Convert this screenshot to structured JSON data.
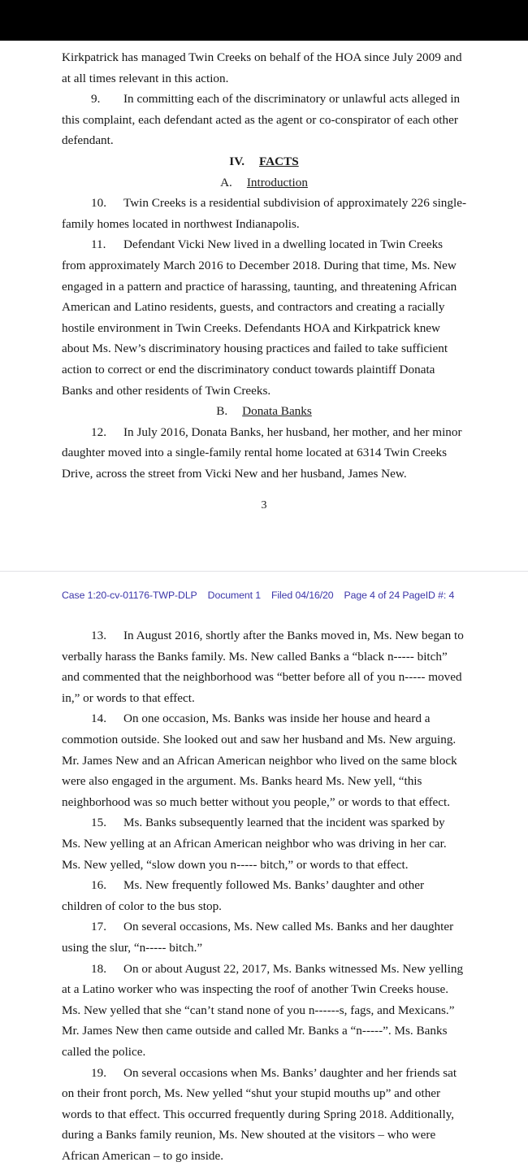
{
  "viewer": {
    "top_band_label": "pdf-toolbar-band"
  },
  "page_one": {
    "continued_paragraph": "Kirkpatrick has managed Twin Creeks on behalf of the HOA since July 2009 and at all times relevant in this action.",
    "paragraphs": [
      {
        "number": "9.",
        "text": "In committing each of the discriminatory or unlawful acts alleged in this complaint, each defendant acted as the agent or co-conspirator of each other defendant."
      }
    ],
    "heading_roman": {
      "numeral": "IV.",
      "label": "FACTS"
    },
    "heading_alpha_a": {
      "letter": "A.",
      "label": "Introduction"
    },
    "paragraphs_after_a": [
      {
        "number": "10.",
        "text": "Twin Creeks is a residential subdivision of approximately 226 single-family homes located in northwest Indianapolis."
      },
      {
        "number": "11.",
        "text": "Defendant Vicki New lived in a dwelling located in Twin Creeks from approximately March 2016 to December 2018. During that time, Ms. New engaged in a pattern and practice of harassing, taunting, and threatening African American and Latino residents, guests, and contractors and creating a racially hostile environment in Twin Creeks. Defendants HOA and Kirkpatrick knew about Ms. New’s discriminatory housing practices and failed to take sufficient action to correct or end the discriminatory conduct towards plaintiff Donata Banks and other residents of Twin Creeks."
      }
    ],
    "heading_alpha_b": {
      "letter": "B.",
      "label": "Donata Banks"
    },
    "paragraphs_after_b": [
      {
        "number": "12.",
        "text": "In July 2016, Donata Banks, her husband, her mother, and her minor daughter moved into a single-family rental home located at 6314 Twin Creeks Drive, across the street from Vicki New and her husband, James New."
      }
    ],
    "folio": "3"
  },
  "page_two": {
    "ecf_stamp": {
      "case": "Case 1:20-cv-01176-TWP-DLP",
      "document": "Document 1",
      "filed": "Filed 04/16/20",
      "page": "Page 4 of 24 PageID #: 4"
    },
    "paragraphs": [
      {
        "number": "13.",
        "text": "In August 2016, shortly after the Banks moved in, Ms. New began to verbally harass the Banks family. Ms. New called Banks a “black n----- bitch” and commented that the neighborhood was “better before all of you n----- moved in,” or words to that effect."
      },
      {
        "number": "14.",
        "text": "On one occasion, Ms. Banks was inside her house and heard a commotion outside. She looked out and saw her husband and Ms. New arguing. Mr. James New and an African American neighbor who lived on the same block were also engaged in the argument. Ms. Banks heard Ms. New yell, “this neighborhood was so much better without you people,” or words to that effect."
      },
      {
        "number": "15.",
        "text": "Ms. Banks subsequently learned that the incident was sparked by Ms. New yelling at an African American neighbor who was driving in her car. Ms. New yelled, “slow down you n----- bitch,” or words to that effect."
      },
      {
        "number": "16.",
        "text": "Ms. New frequently followed Ms. Banks’ daughter and other children of color to the bus stop."
      },
      {
        "number": "17.",
        "text": "On several occasions, Ms. New called Ms. Banks and her daughter using the slur, “n----- bitch.”"
      },
      {
        "number": "18.",
        "text": "On or about August 22, 2017, Ms. Banks witnessed Ms. New yelling at a Latino worker who was inspecting the roof of another Twin Creeks house. Ms. New yelled that she “can’t stand none of you n------s, fags, and Mexicans.” Mr. James New then came outside and called Mr. Banks a “n-----”. Ms. Banks called the police."
      },
      {
        "number": "19.",
        "text": "On several occasions when Ms. Banks’ daughter and her friends sat on their front porch, Ms. New yelled “shut your stupid mouths up” and other words to that effect. This occurred frequently during Spring 2018. Additionally, during a Banks family reunion, Ms. New shouted at the visitors – who were African American – to go inside."
      }
    ]
  }
}
